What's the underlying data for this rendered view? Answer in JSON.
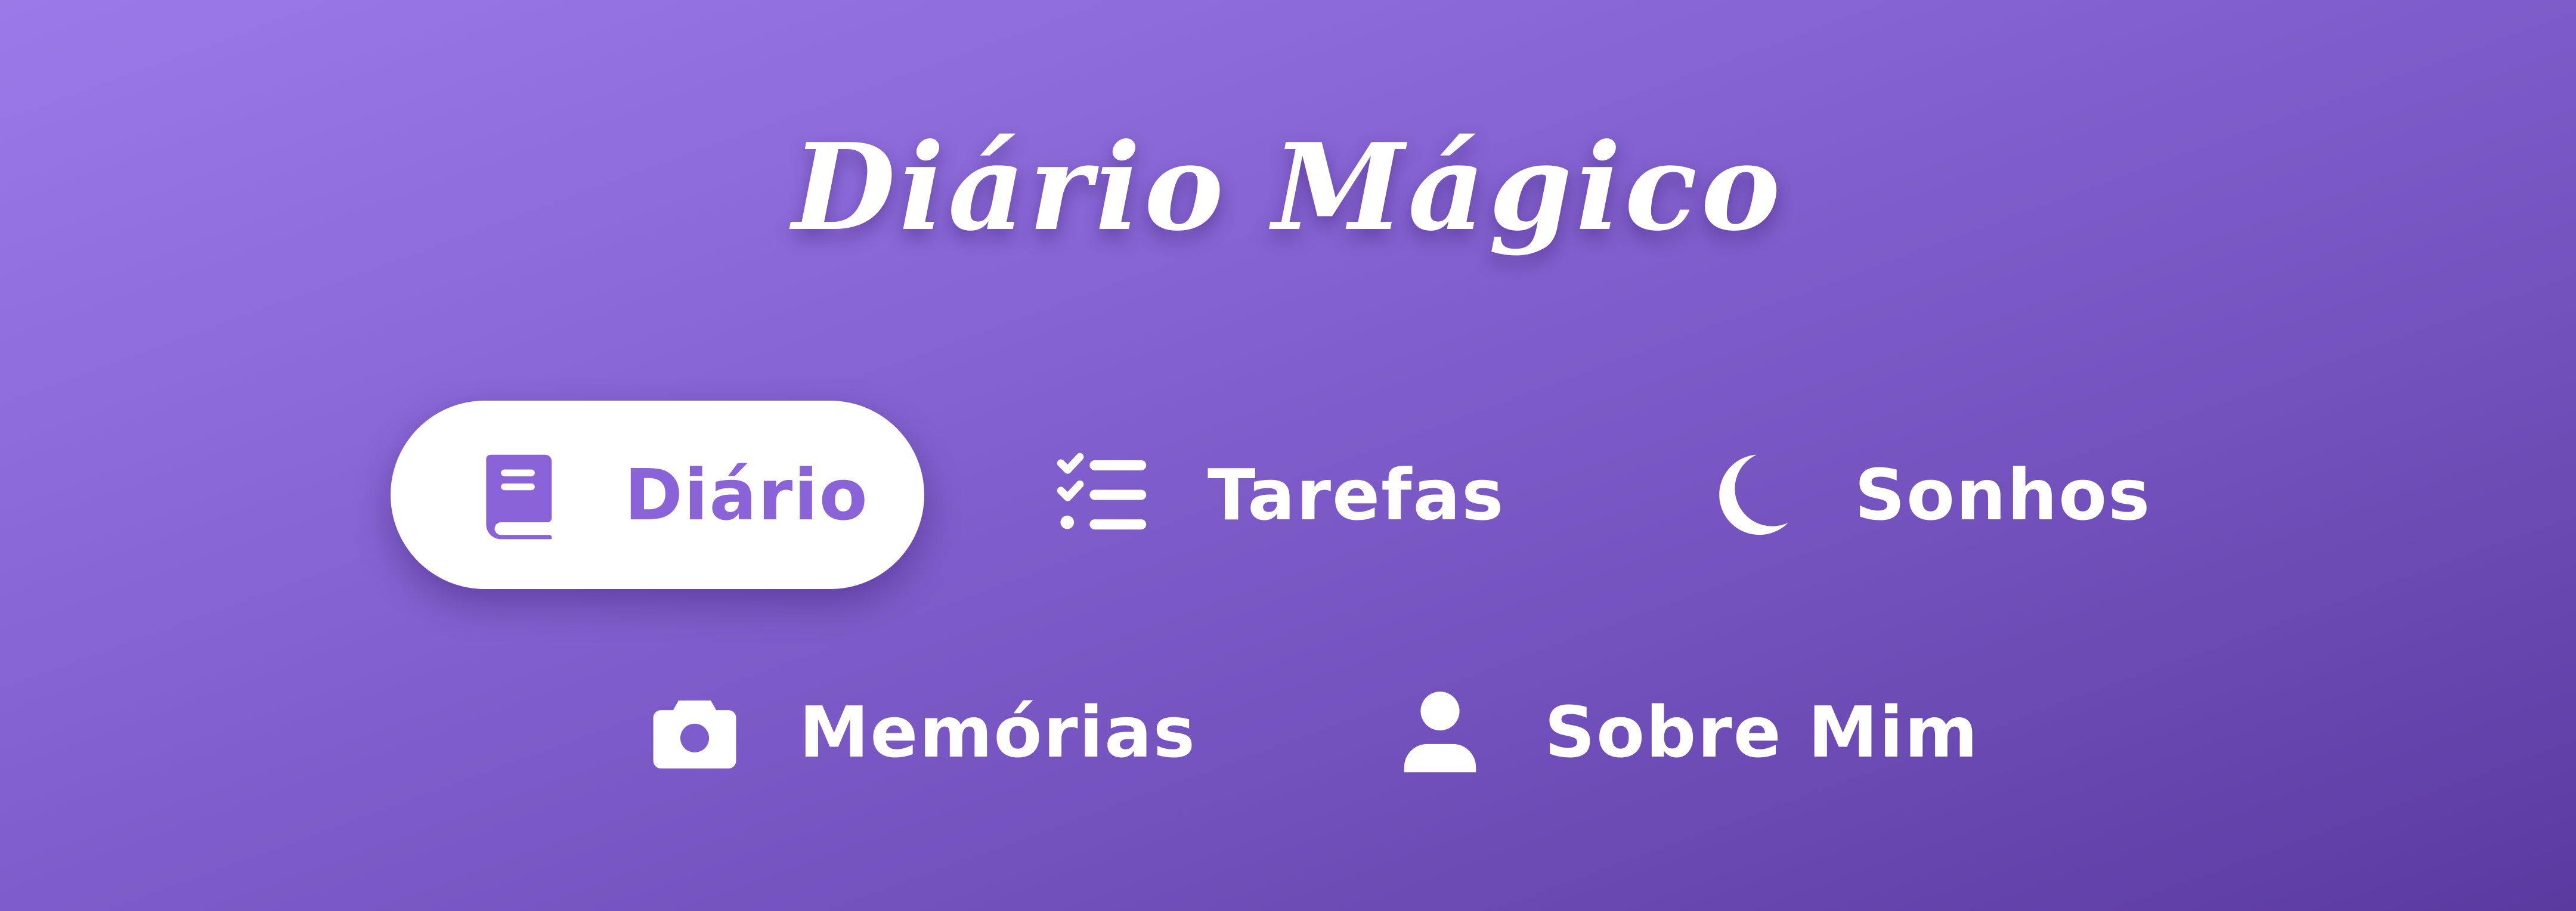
{
  "app": {
    "title": "Diário Mágico"
  },
  "nav": {
    "items": [
      {
        "label": "Diário",
        "icon": "book-icon",
        "active": true
      },
      {
        "label": "Tarefas",
        "icon": "checklist-icon",
        "active": false
      },
      {
        "label": "Sonhos",
        "icon": "moon-icon",
        "active": false
      },
      {
        "label": "Memórias",
        "icon": "camera-icon",
        "active": false
      },
      {
        "label": "Sobre Mim",
        "icon": "user-icon",
        "active": false
      }
    ]
  },
  "colors": {
    "background_start": "#9b7ae8",
    "background_end": "#5b3aa0",
    "active_pill": "#ffffff",
    "active_accent": "#8a63d9",
    "text": "#ffffff"
  }
}
